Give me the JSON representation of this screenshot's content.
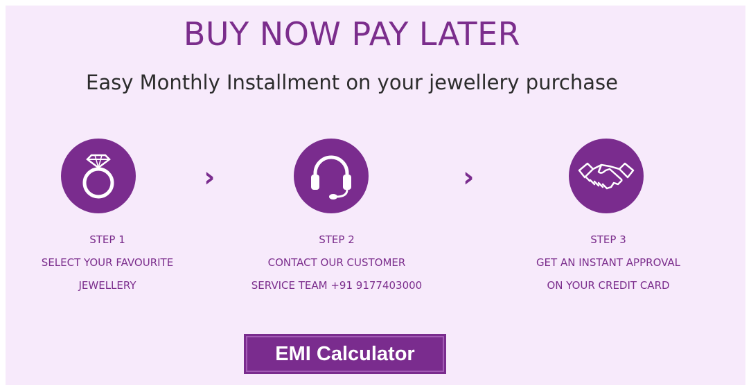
{
  "header": {
    "title": "BUY NOW PAY LATER",
    "subtitle": "Easy Monthly Installment on your jewellery purchase"
  },
  "steps": [
    {
      "icon": "diamond-ring-icon",
      "step_label": "STEP 1",
      "line1": "SELECT YOUR FAVOURITE",
      "line2": "JEWELLERY"
    },
    {
      "icon": "headset-icon",
      "step_label": "STEP 2",
      "line1": "CONTACT OUR CUSTOMER",
      "line2": "SERVICE TEAM +91 9177403000"
    },
    {
      "icon": "handshake-icon",
      "step_label": "STEP 3",
      "line1": "GET AN INSTANT APPROVAL",
      "line2": "ON YOUR CREDIT CARD"
    }
  ],
  "arrow_glyph": "›",
  "emi_button": {
    "label": "EMI Calculator"
  },
  "colors": {
    "accent": "#7a2c8e",
    "background": "#f7eafb",
    "text_dark": "#2c2c2c"
  }
}
